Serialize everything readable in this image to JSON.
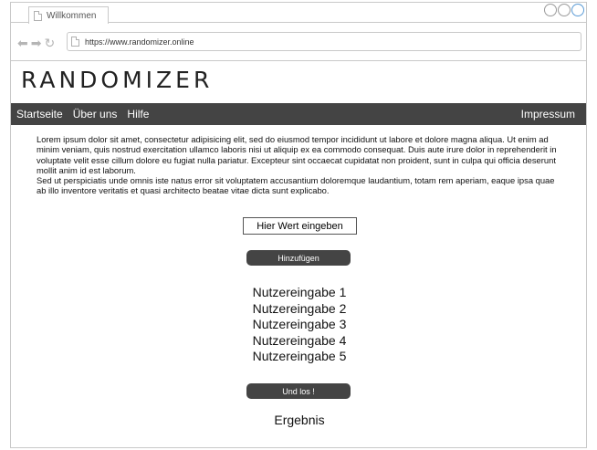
{
  "browser": {
    "tab_title": "Willkommen",
    "url": "https://www.randomizer.online"
  },
  "site": {
    "logo": "RANDOMIZER"
  },
  "nav": {
    "items": [
      {
        "label": "Startseite"
      },
      {
        "label": "Über uns"
      },
      {
        "label": "Hilfe"
      }
    ],
    "right": "Impressum"
  },
  "content": {
    "paragraph_1": "Lorem ipsum dolor sit amet, consectetur adipisicing elit, sed do eiusmod tempor incididunt ut labore et dolore magna aliqua. Ut enim ad minim veniam, quis nostrud exercitation ullamco laboris nisi ut aliquip ex ea commodo consequat. Duis aute irure dolor in reprehenderit in voluptate velit esse cillum dolore eu fugiat nulla pariatur. Excepteur sint occaecat cupidatat non proident, sunt in culpa qui officia deserunt mollit anim id est laborum.",
    "paragraph_2": "Sed ut perspiciatis unde omnis iste natus error sit voluptatem accusantium doloremque laudantium, totam rem aperiam, eaque ipsa quae ab illo inventore veritatis et quasi architecto beatae vitae dicta sunt explicabo.",
    "input_placeholder": "Hier Wert eingeben",
    "add_button": "Hinzufügen",
    "entries": [
      "Nutzereingabe 1",
      "Nutzereingabe 2",
      "Nutzereingabe 3",
      "Nutzereingabe 4",
      "Nutzereingabe 5"
    ],
    "go_button": "Und los !",
    "result": "Ergebnis"
  }
}
